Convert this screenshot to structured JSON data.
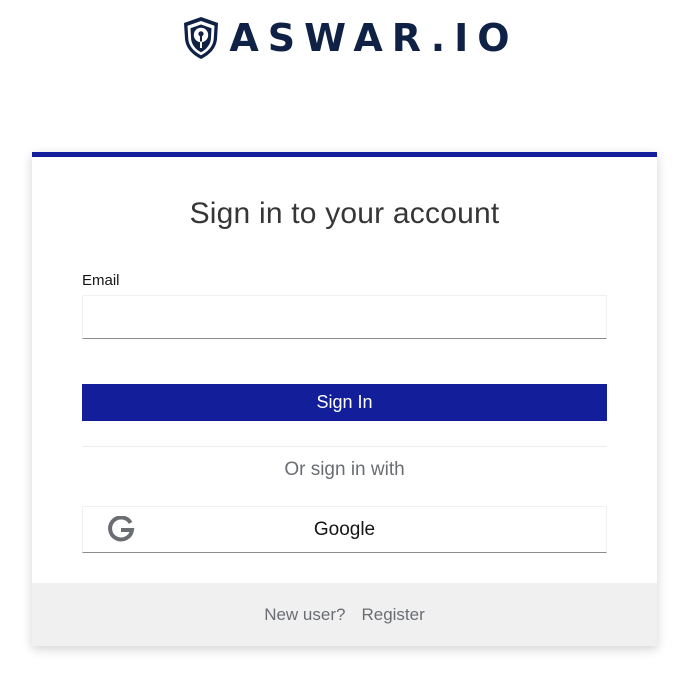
{
  "brand": {
    "name": "ASWAR.IO",
    "logo_icon": "shield-keyhole-icon",
    "color": "#0f2145"
  },
  "login": {
    "title": "Sign in to your account",
    "email_label": "Email",
    "email_value": "",
    "signin_label": "Sign In",
    "or_signin_label": "Or sign in with",
    "providers": [
      {
        "label": "Google",
        "icon": "google-icon"
      }
    ],
    "accent_color": "#121e9a"
  },
  "footer": {
    "new_user_label": "New user?",
    "register_label": "Register"
  }
}
